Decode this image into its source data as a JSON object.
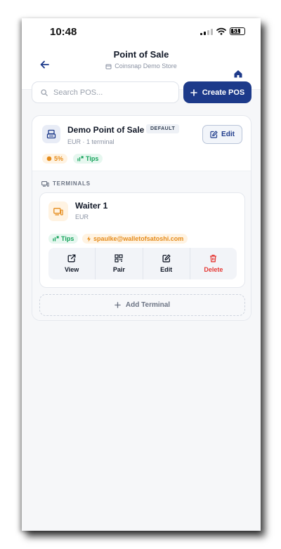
{
  "status_bar": {
    "time": "10:48",
    "battery": "51"
  },
  "header": {
    "title": "Point of Sale",
    "subtitle": "Coinsnap Demo Store"
  },
  "search": {
    "placeholder": "Search POS..."
  },
  "create_button": {
    "label": "Create POS"
  },
  "pos": {
    "name": "Demo Point of Sale",
    "badge": "DEFAULT",
    "meta": "EUR · 1 terminal",
    "edit_label": "Edit",
    "tags": {
      "fee": "5%",
      "tips": "Tips"
    }
  },
  "terminals": {
    "section_label": "TERMINALS",
    "items": [
      {
        "name": "Waiter 1",
        "currency": "EUR",
        "tags": {
          "tips": "Tips",
          "lightning_address": "spaulke@walletofsatoshi.com"
        },
        "actions": {
          "view": "View",
          "pair": "Pair",
          "edit": "Edit",
          "delete": "Delete"
        }
      }
    ],
    "add_label": "Add Terminal"
  },
  "colors": {
    "primary": "#1d3a8a",
    "tips_green": "#16a35b",
    "fee_orange": "#e58b1a",
    "delete_red": "#e53935"
  }
}
